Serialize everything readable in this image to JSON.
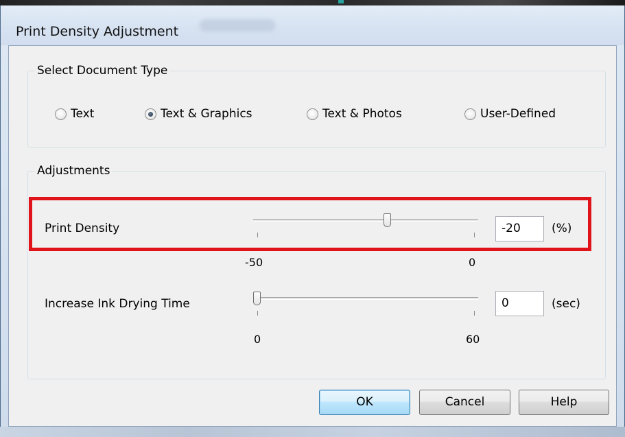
{
  "window": {
    "title": "Print Density Adjustment"
  },
  "document_type": {
    "group_title": "Select Document Type",
    "options": [
      {
        "label": "Text",
        "selected": false
      },
      {
        "label": "Text & Graphics",
        "selected": true
      },
      {
        "label": "Text & Photos",
        "selected": false
      },
      {
        "label": "User-Defined",
        "selected": false
      }
    ]
  },
  "adjustments": {
    "group_title": "Adjustments",
    "print_density": {
      "label": "Print Density",
      "value": "-20",
      "unit": "(%)",
      "min_label": "-50",
      "max_label": "0",
      "min": -50,
      "max": 0
    },
    "ink_drying_time": {
      "label": "Increase Ink Drying Time",
      "value": "0",
      "unit": "(sec)",
      "min_label": "0",
      "max_label": "60",
      "min": 0,
      "max": 60
    }
  },
  "buttons": {
    "ok": "OK",
    "cancel": "Cancel",
    "help": "Help"
  },
  "colors": {
    "highlight": "#e0131b",
    "default_button_border": "#3c7fb1"
  },
  "icons": {
    "radio_unchecked": "radio-unchecked-icon",
    "radio_checked": "radio-checked-icon"
  }
}
